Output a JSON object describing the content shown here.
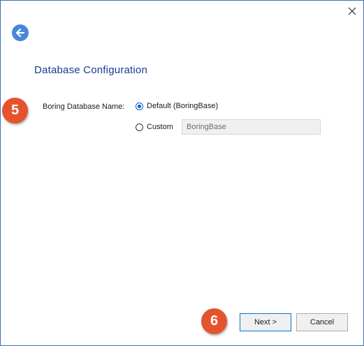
{
  "window": {
    "close_icon": "close-icon",
    "back_icon": "arrow-left-icon"
  },
  "page": {
    "title": "Database Configuration"
  },
  "annotations": {
    "step_5": "5",
    "step_6": "6"
  },
  "form": {
    "db_name_label": "Boring Database Name:",
    "options": [
      {
        "label": "Default (BoringBase)",
        "checked": true
      },
      {
        "label": "Custom",
        "checked": false
      }
    ],
    "custom_value": "BoringBase"
  },
  "footer": {
    "next_label": "Next >",
    "cancel_label": "Cancel"
  },
  "colors": {
    "accent": "#4a86d8",
    "title": "#1a3a8f",
    "badge": "#e5532d"
  }
}
